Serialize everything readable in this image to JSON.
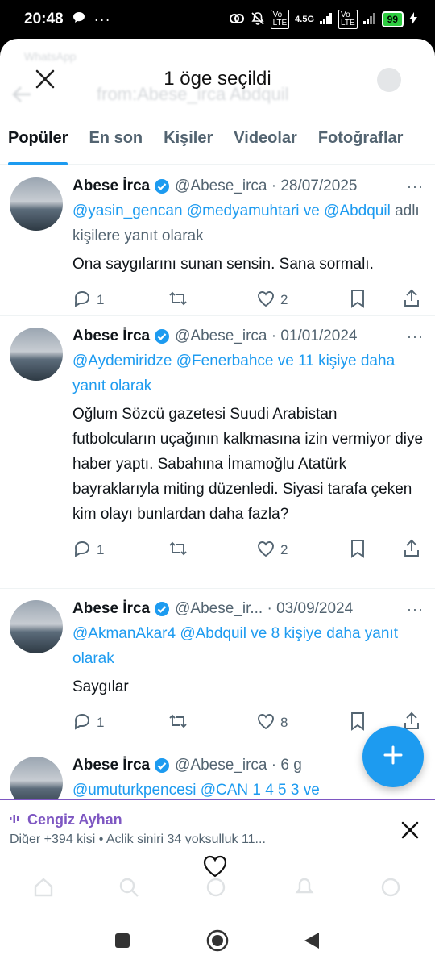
{
  "status_bar": {
    "time": "20:48",
    "network_label": "4.5G",
    "battery": "99"
  },
  "background_app": {
    "app_name": "WhatsApp",
    "search_query": "from:Abese_irca Abdquil"
  },
  "selection_header": {
    "title": "1 öge seçildi"
  },
  "tabs": [
    {
      "label": "Popüler",
      "active": true
    },
    {
      "label": "En son",
      "active": false
    },
    {
      "label": "Kişiler",
      "active": false
    },
    {
      "label": "Videolar",
      "active": false
    },
    {
      "label": "Fotoğraflar",
      "active": false
    }
  ],
  "tweets": [
    {
      "name": "Abese İrca",
      "handle": "@Abese_irca",
      "date": "28/07/2025",
      "reply_mentions": "@yasin_gencan @medyamuhtari ve @Abdquil",
      "reply_suffix": "adlı kişilere yanıt olarak",
      "body": "Ona saygılarını sunan sensin. Sana sormalı.",
      "replies": "1",
      "retweets": "",
      "likes": "2"
    },
    {
      "name": "Abese İrca",
      "handle": "@Abese_irca",
      "date": "01/01/2024",
      "reply_mentions": "@Aydemiridze @Fenerbahce ve 11 kişiye daha yanıt olarak",
      "reply_suffix": "",
      "body": "Oğlum Sözcü gazetesi Suudi Arabistan futbolcuların uçağının kalkmasına izin vermiyor diye haber yaptı. Sabahına İmamoğlu Atatürk bayraklarıyla miting düzenledi. Siyasi tarafa çeken kim olayı bunlardan daha fazla?",
      "replies": "1",
      "retweets": "",
      "likes": "2"
    },
    {
      "name": "Abese İrca",
      "handle": "@Abese_ir...",
      "date": "03/09/2024",
      "reply_mentions": "@AkmanAkar4 @Abdquil ve 8 kişiye daha yanıt olarak",
      "reply_suffix": "",
      "body": "Saygılar",
      "replies": "1",
      "retweets": "",
      "likes": "8"
    },
    {
      "name": "Abese İrca",
      "handle": "@Abese_irca",
      "date": "6 g",
      "reply_mentions": "@umuturkpencesi @CAN 1 4 5 3 ve",
      "reply_suffix": "",
      "body": "",
      "replies": "",
      "retweets": "",
      "likes": ""
    }
  ],
  "spaces_bar": {
    "host": "Cengiz Ayhan",
    "subtitle": "Diğer +394 kişi • Aclik siniri 34 yoksulluk 11..."
  },
  "colors": {
    "accent": "#1d9bf0",
    "spaces": "#7e57c2",
    "text_secondary": "#536471"
  }
}
